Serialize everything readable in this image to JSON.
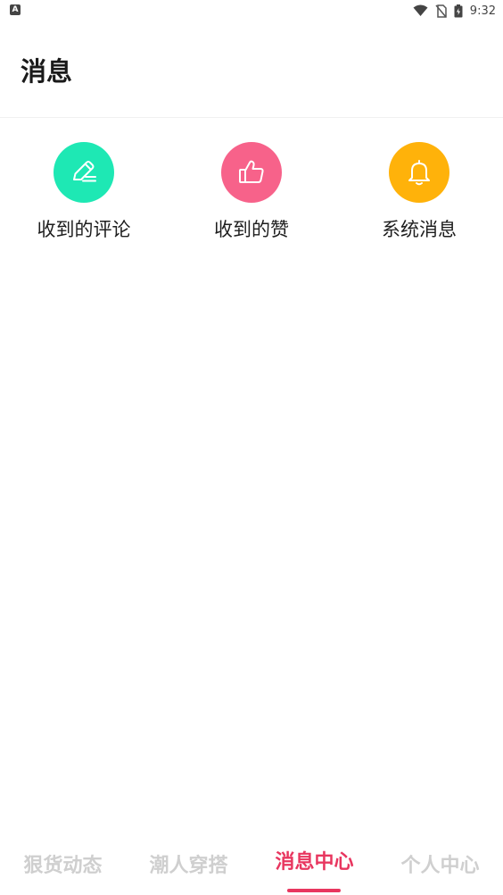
{
  "status_bar": {
    "app_indicator": "A",
    "time": "9:32"
  },
  "header": {
    "title": "消息"
  },
  "categories": [
    {
      "label": "收到的评论",
      "icon": "pencil-icon",
      "color": "#1ee8b4"
    },
    {
      "label": "收到的赞",
      "icon": "thumbs-up-icon",
      "color": "#f7628a"
    },
    {
      "label": "系统消息",
      "icon": "bell-icon",
      "color": "#ffb20a"
    }
  ],
  "tab_bar": {
    "tabs": [
      {
        "label": "狠货动态",
        "active": false
      },
      {
        "label": "潮人穿搭",
        "active": false
      },
      {
        "label": "消息中心",
        "active": true
      },
      {
        "label": "个人中心",
        "active": false
      }
    ],
    "active_color": "#e8365f",
    "inactive_color": "#cfcfcf"
  }
}
